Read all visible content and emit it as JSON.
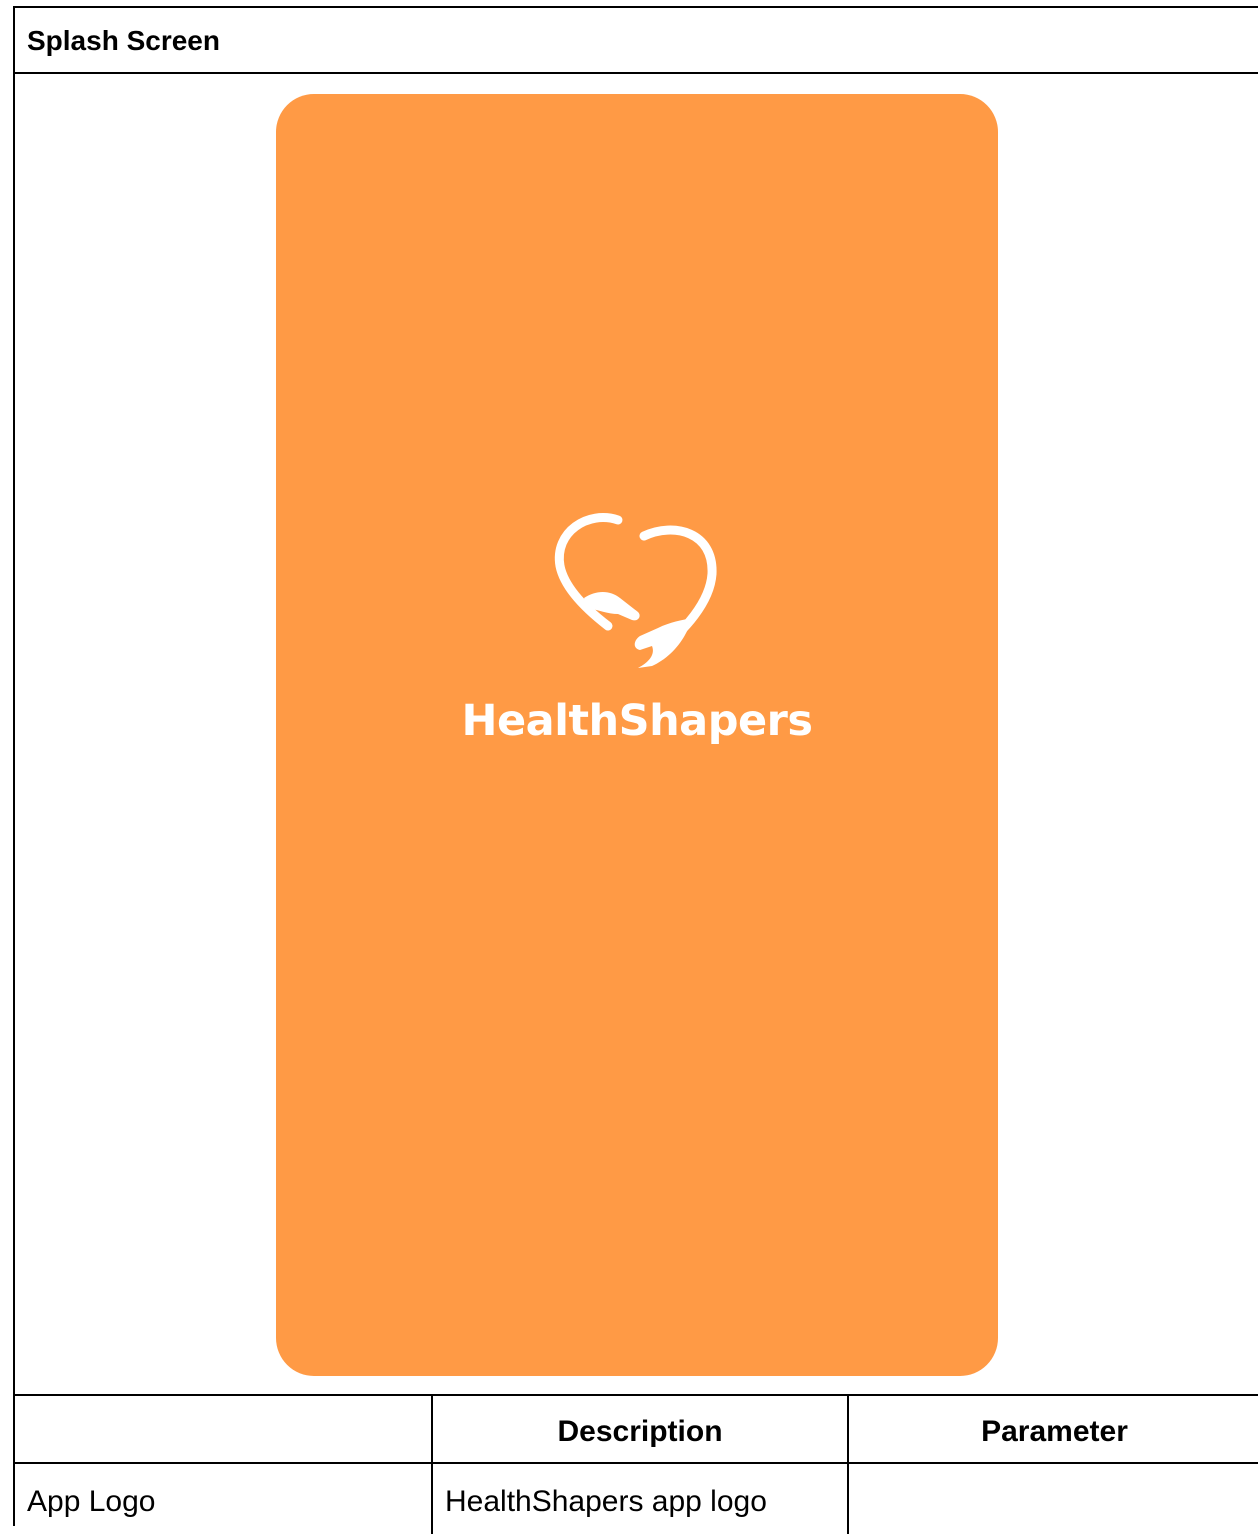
{
  "section": {
    "title": "Splash Screen"
  },
  "splash": {
    "background_color": "#FF9A45",
    "logo_icon": "heart-hands-icon",
    "brand_name": "HealthShapers"
  },
  "spec_table": {
    "headers": [
      "",
      "Description",
      "Parameter"
    ],
    "rows": [
      [
        "App Logo",
        "HealthShapers app logo",
        ""
      ]
    ]
  }
}
